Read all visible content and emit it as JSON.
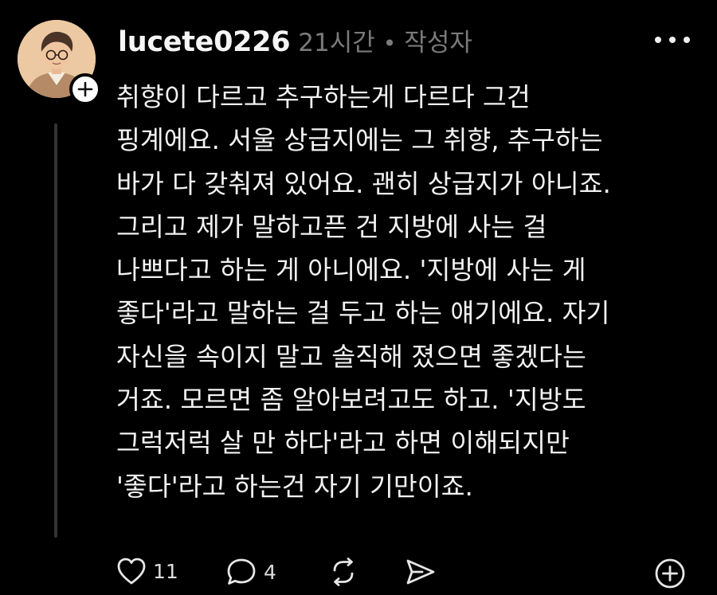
{
  "post": {
    "username": "lucete0226",
    "time": "21시간",
    "separator": "•",
    "author_tag": "작성자",
    "lines": [
      "취향이 다르고 추구하는게 다르다 그건",
      "핑계에요. 서울 상급지에는 그 취향, 추구하는",
      "바가 다 갖춰져 있어요. 괜히 상급지가 아니죠.",
      "그리고 제가 말하고픈 건 지방에 사는 걸",
      "나쁘다고 하는 게 아니에요. '지방에 사는 게",
      "좋다'라고 말하는 걸 두고 하는 얘기에요. 자기",
      "자신을 속이지 말고 솔직해 졌으면 좋겠다는",
      "거죠. 모르면 좀 알아보려고도 하고. '지방도",
      "그럭저럭 살 만 하다'라고 하면 이해되지만",
      "'좋다'라고 하는건 자기 기만이죠."
    ]
  },
  "actions": {
    "like_count": "11",
    "comment_count": "4"
  },
  "icons": {
    "avatar": "avatar-portrait",
    "follow": "plus-icon",
    "more": "more-dots-icon",
    "like": "heart-icon",
    "comment": "comment-bubble-icon",
    "repost": "repost-icon",
    "share": "send-icon",
    "add": "add-circle-icon"
  },
  "colors": {
    "background": "#000000",
    "text": "#f2f2f2",
    "meta": "#7a7a7a",
    "thread_line": "#333333"
  }
}
